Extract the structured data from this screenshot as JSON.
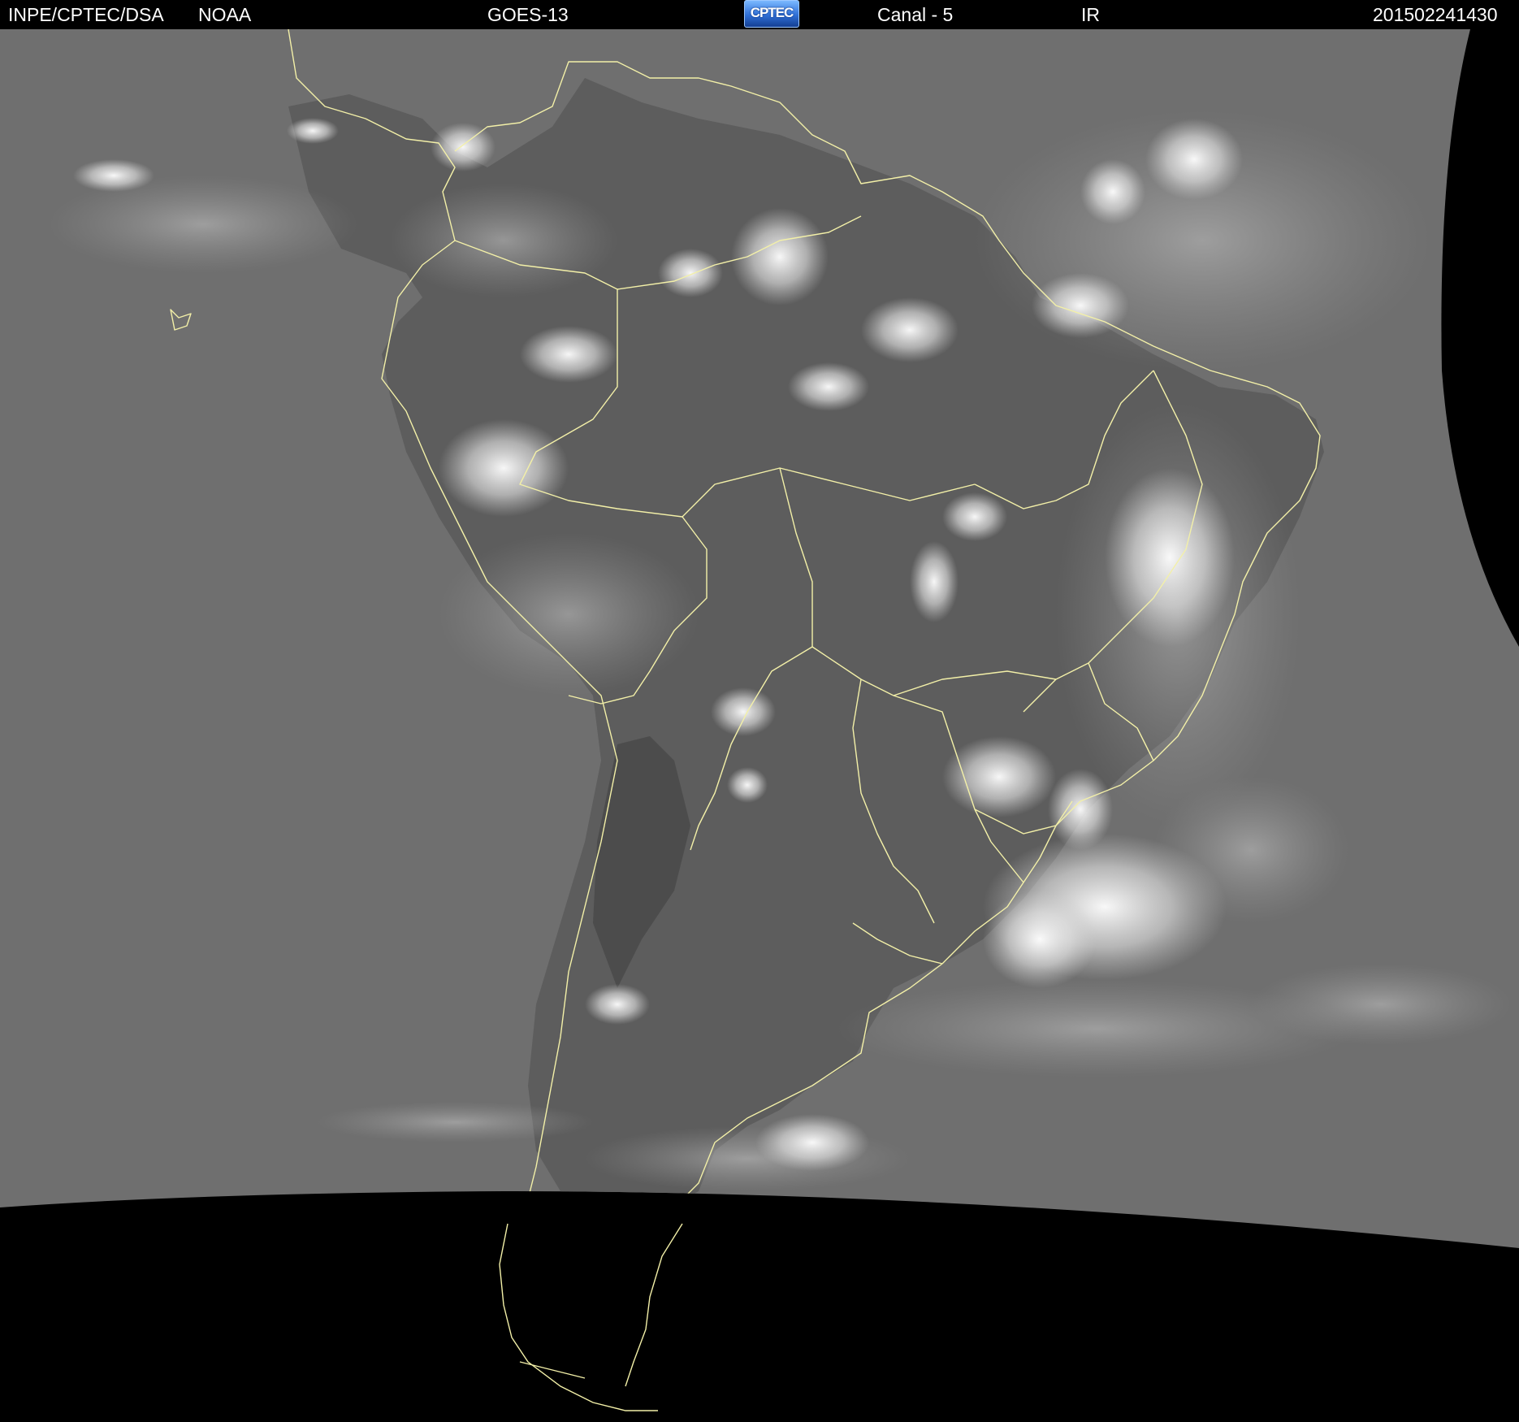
{
  "header": {
    "source": "INPE/CPTEC/DSA",
    "agency": "NOAA",
    "satellite": "GOES-13",
    "logo_text": "CPTEC",
    "channel": "Canal - 5",
    "band": "IR",
    "timestamp": "201502241430"
  },
  "colors": {
    "space": "#000000",
    "ocean_ir": "#6f6f6f",
    "land_ir": "#5a5a5a",
    "cloud": "#f2f2f2",
    "borders": "#f3f0a8",
    "logo_blue": "#2f6fd6"
  }
}
